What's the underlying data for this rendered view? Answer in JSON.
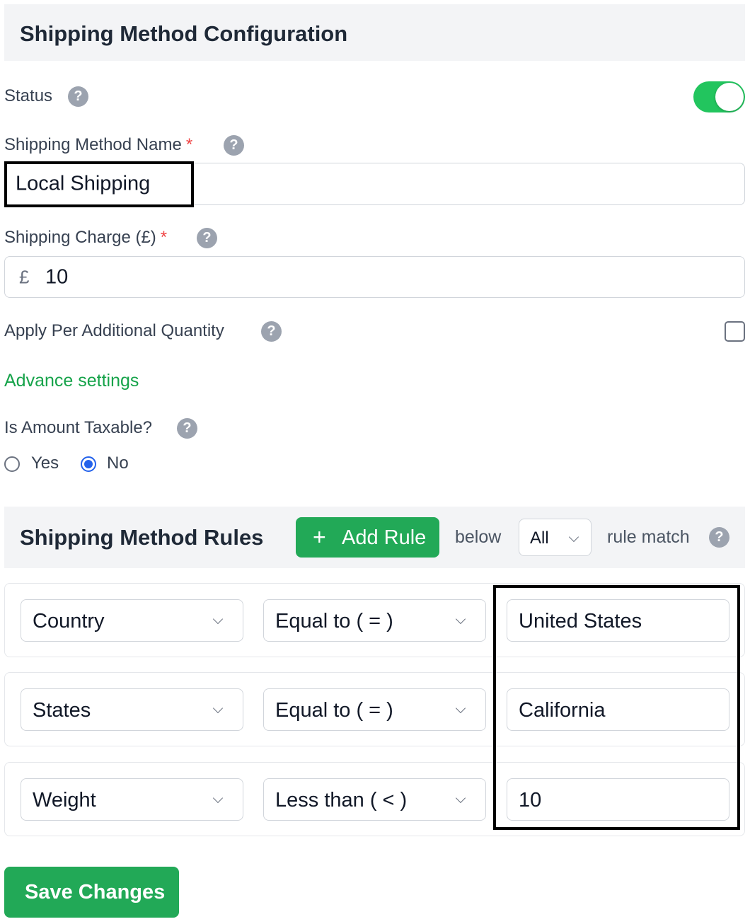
{
  "header": {
    "title": "Shipping Method Configuration"
  },
  "status": {
    "label": "Status",
    "help": "?",
    "enabled": true
  },
  "method_name": {
    "label": "Shipping Method Name",
    "required_mark": "*",
    "help": "?",
    "value": "Local Shipping"
  },
  "charge": {
    "label": "Shipping Charge (£)",
    "required_mark": "*",
    "help": "?",
    "currency_symbol": "£",
    "value": "10"
  },
  "additional_qty": {
    "label": "Apply Per Additional Quantity",
    "help": "?",
    "checked": false
  },
  "advance_settings": {
    "label": "Advance settings"
  },
  "taxable": {
    "label": "Is Amount Taxable?",
    "help": "?",
    "options": [
      {
        "label": "Yes",
        "checked": false
      },
      {
        "label": "No",
        "checked": true
      }
    ]
  },
  "rules": {
    "title": "Shipping Method Rules",
    "add_plus": "+",
    "add_label": "Add Rule",
    "below_text": "below",
    "match_value": "All",
    "match_text": "rule match",
    "help": "?",
    "rows": [
      {
        "field": "Country",
        "operator": "Equal to ( = )",
        "value": "United States"
      },
      {
        "field": "States",
        "operator": "Equal to ( = )",
        "value": "California"
      },
      {
        "field": "Weight",
        "operator": "Less than ( < )",
        "value": "10"
      }
    ]
  },
  "footer": {
    "save_label": "Save Changes"
  },
  "colors": {
    "accent_green": "#22a957",
    "toggle_green": "#22c55e",
    "link_green": "#16a34a",
    "radio_blue": "#2563eb",
    "required_red": "#ef4444"
  }
}
